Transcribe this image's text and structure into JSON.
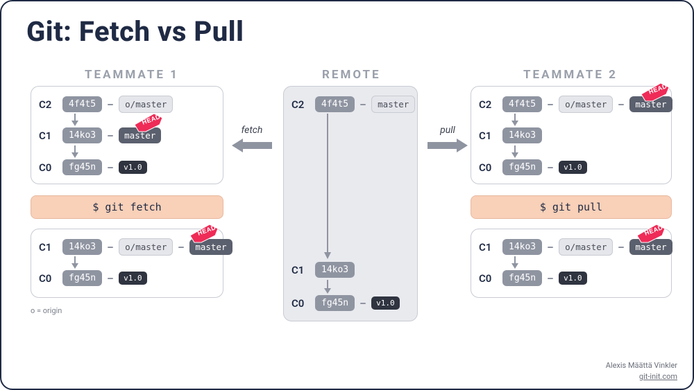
{
  "title": "Git: Fetch vs Pull",
  "headers": {
    "left": "TEAMMATE 1",
    "center": "REMOTE",
    "right": "TEAMMATE 2"
  },
  "commands": {
    "left": "$ git fetch",
    "right": "$ git pull"
  },
  "arrows": {
    "fetch": "fetch",
    "pull": "pull"
  },
  "commits": {
    "c2": "C2",
    "c1": "C1",
    "c0": "C0",
    "h_c2": "4f4t5",
    "h_c1": "14ko3",
    "h_c0": "fg45n"
  },
  "labels": {
    "omaster": "o/master",
    "master": "master",
    "tag_v1": "v1.0",
    "head": "HEAD"
  },
  "footnote": "o = origin",
  "credit": {
    "name": "Alexis Määttä Vinkler",
    "url": "git-init.com"
  }
}
